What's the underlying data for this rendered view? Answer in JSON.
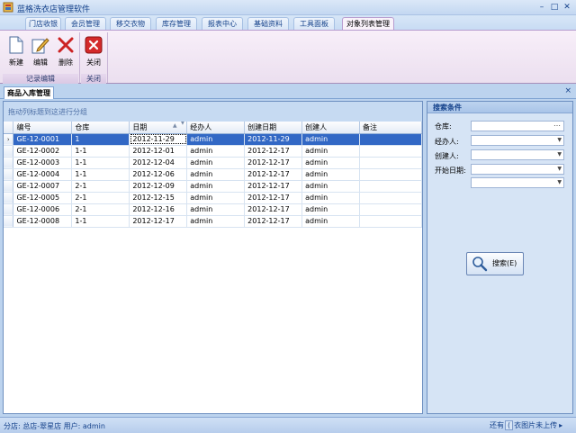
{
  "window": {
    "title": "蓝格洗衣店管理软件",
    "minimize_glyph": "–",
    "maximize_glyph": "□",
    "close_glyph": "✕"
  },
  "menu_tabs": [
    "门店收银",
    "会员管理",
    "移交衣物",
    "库存管理",
    "报表中心",
    "基础资料",
    "工具面板",
    "对象列表管理"
  ],
  "active_menu_tab": "对象列表管理",
  "ribbon": {
    "buttons": {
      "new": "新建",
      "edit": "编辑",
      "delete": "删除",
      "close": "关闭"
    },
    "groups": {
      "record_edit": "记录编辑",
      "close": "关闭"
    }
  },
  "document_tab": {
    "label": "商品入库管理",
    "close_glyph": "×"
  },
  "grid": {
    "group_hint": "拖动列标题到这进行分组",
    "columns": [
      "编号",
      "仓库",
      "日期",
      "经办人",
      "创建日期",
      "创建人",
      "备注"
    ],
    "sorted_column": "日期",
    "rows": [
      [
        "GE-12-0001",
        "1",
        "2012-11-29",
        "admin",
        "2012-11-29",
        "admin",
        ""
      ],
      [
        "GE-12-0002",
        "1-1",
        "2012-12-01",
        "admin",
        "2012-12-17",
        "admin",
        ""
      ],
      [
        "GE-12-0003",
        "1-1",
        "2012-12-04",
        "admin",
        "2012-12-17",
        "admin",
        ""
      ],
      [
        "GE-12-0004",
        "1-1",
        "2012-12-06",
        "admin",
        "2012-12-17",
        "admin",
        ""
      ],
      [
        "GE-12-0007",
        "2-1",
        "2012-12-09",
        "admin",
        "2012-12-17",
        "admin",
        ""
      ],
      [
        "GE-12-0005",
        "2-1",
        "2012-12-15",
        "admin",
        "2012-12-17",
        "admin",
        ""
      ],
      [
        "GE-12-0006",
        "2-1",
        "2012-12-16",
        "admin",
        "2012-12-17",
        "admin",
        ""
      ],
      [
        "GE-12-0008",
        "1-1",
        "2012-12-17",
        "admin",
        "2012-12-17",
        "admin",
        ""
      ]
    ],
    "selected_row": 0,
    "row_indicator": "›"
  },
  "search_panel": {
    "title": "搜索条件",
    "fields": {
      "warehouse": {
        "label": "仓库:",
        "value": ""
      },
      "handler": {
        "label": "经办人:",
        "value": ""
      },
      "creator": {
        "label": "创建人:",
        "value": ""
      },
      "start_date": {
        "label": "开始日期:",
        "value": ""
      },
      "end_date": {
        "value": ""
      }
    },
    "search_button": "搜索(E)"
  },
  "statusbar": {
    "left": "分店: 总店-翠星店  用户: admin",
    "right_1": "还有",
    "right_2": "(",
    "right_3": "衣图片未上传",
    "right_arrow": "▸"
  },
  "colors": {
    "selection": "#3268c5",
    "ribbon_bg": "#f4e9f6",
    "frame_bg": "#bcd3ee",
    "delete_red": "#cc2222"
  },
  "icons": [
    "app-icon",
    "new-document-icon",
    "edit-pencil-icon",
    "delete-x-icon",
    "close-red-icon",
    "magnifier-icon",
    "dropdown-arrow-icon",
    "ellipsis-icon",
    "sort-ascending-icon",
    "filter-icon"
  ]
}
